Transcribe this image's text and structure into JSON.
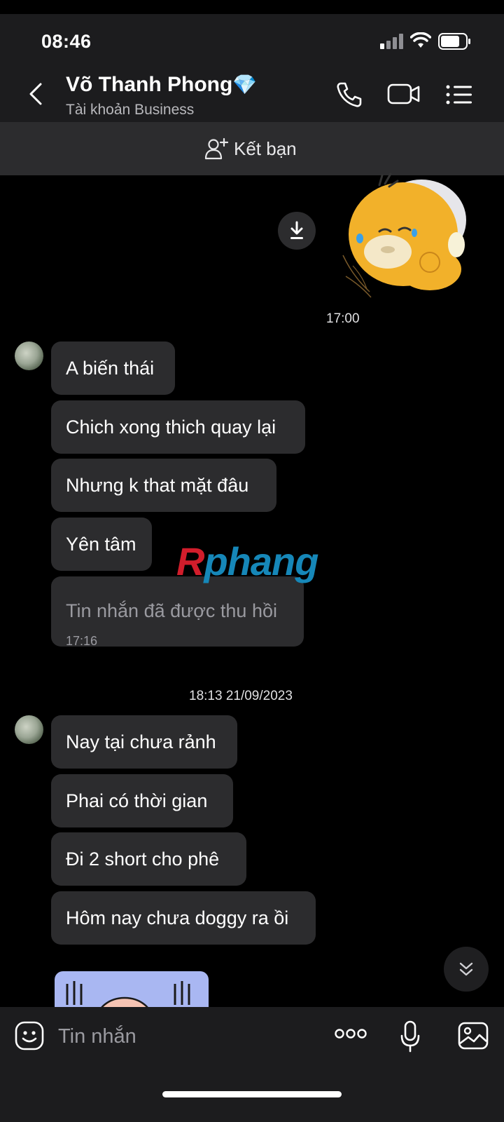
{
  "status_bar": {
    "time": "08:46"
  },
  "header": {
    "contact_name": "Võ Thanh Phong",
    "badge_emoji": "💎",
    "subtitle": "Tài khoản Business",
    "icons": [
      "back-icon",
      "phone-icon",
      "video-icon",
      "menu-list-icon"
    ]
  },
  "friend_bar": {
    "label": "Kết bạn"
  },
  "sticker_top": {
    "timestamp": "17:00"
  },
  "group1": {
    "messages": [
      "A biến thái",
      "Chich xong thich quay lại",
      "Nhưng k that mặt đâu",
      "Yên tâm"
    ],
    "recalled": {
      "text": "Tin nhắn đã được thu hồi",
      "time": "17:16"
    }
  },
  "date_separator": "18:13 21/09/2023",
  "group2": {
    "messages": [
      "Nay tại chưa rảnh",
      "Phai có thời gian",
      "Đi 2 short cho phê",
      "Hôm nay chưa doggy ra ồi"
    ]
  },
  "watermark": {
    "part1": "R",
    "part2": "phang"
  },
  "composer": {
    "placeholder": "Tin nhắn"
  },
  "colors": {
    "header_bg": "#1c1c1e",
    "bubble_bg": "#2c2c2e",
    "page_bg": "#000000"
  }
}
